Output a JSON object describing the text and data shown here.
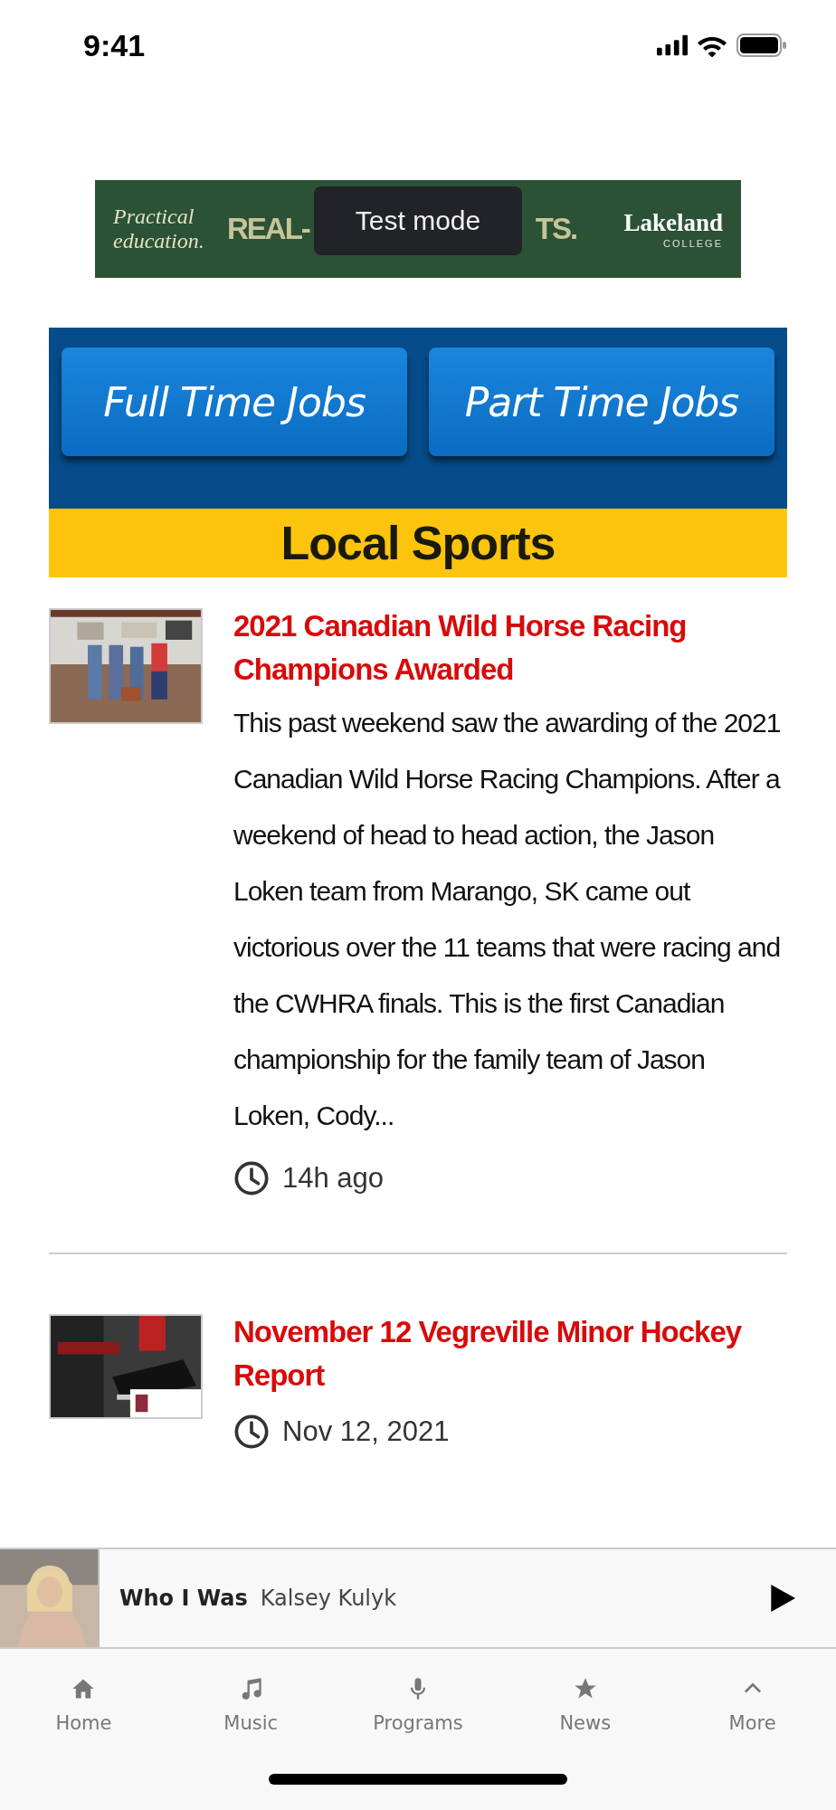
{
  "status_bar": {
    "time": "9:41"
  },
  "ad": {
    "tagline": "Practical education.",
    "headline_left": "REAL-",
    "headline_right": "TS.",
    "brand": "Lakeland",
    "brand_sub": "COLLEGE"
  },
  "toast": {
    "text": "Test mode"
  },
  "job_buttons": [
    "Full Time Jobs",
    "Part Time Jobs"
  ],
  "section_title": "Local Sports",
  "articles": [
    {
      "kind": "picture",
      "title": "2021 Canadian Wild Horse Racing Champions Awarded",
      "summary": "This past weekend saw the awarding of the 2021 Canadian Wild Horse Racing Champions. After a weekend of head to head action, the Jason Loken team from Marango, SK came out victorious over the 11 teams that were racing and the CWHRA finals. This is the first Canadian championship for the family team of Jason Loken, Cody...",
      "time": "14h ago"
    },
    {
      "kind": "picture",
      "title": "November 12 Vegreville Minor Hockey Report",
      "time": "Nov 12, 2021"
    }
  ],
  "player": {
    "kind": "picture",
    "song": "Who I Was",
    "artist": "Kalsey Kulyk",
    "playing": false
  },
  "tabs": [
    {
      "label": "Home"
    },
    {
      "label": "Music"
    },
    {
      "label": "Programs"
    },
    {
      "label": "News"
    },
    {
      "label": "More"
    }
  ]
}
